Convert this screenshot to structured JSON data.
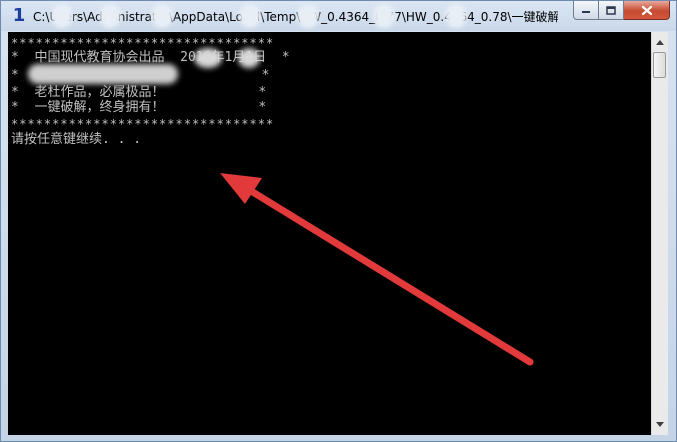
{
  "window": {
    "app_icon_glyph": "1",
    "title": "C:\\Users\\Administrator\\AppData\\Local\\Temp\\HW_0.4364_0.77\\HW_0.4364_0.78\\一键破解Ca...",
    "buttons": {
      "minimize_icon": "minimize-icon",
      "maximize_icon": "maximize-icon",
      "close_icon": "close-icon"
    }
  },
  "console": {
    "lines": [
      "********************************",
      "*  中国现代教育协会出品  2016年1月1日  *",
      "*                               *",
      "*  老杜作品，必属极品！            *",
      "*  一键破解，终身拥有！            *",
      "********************************",
      "请按任意键继续. . ."
    ],
    "text_color": "#c0c0c0",
    "background": "#000000"
  },
  "annotation": {
    "arrow_color": "#e23a3a"
  }
}
